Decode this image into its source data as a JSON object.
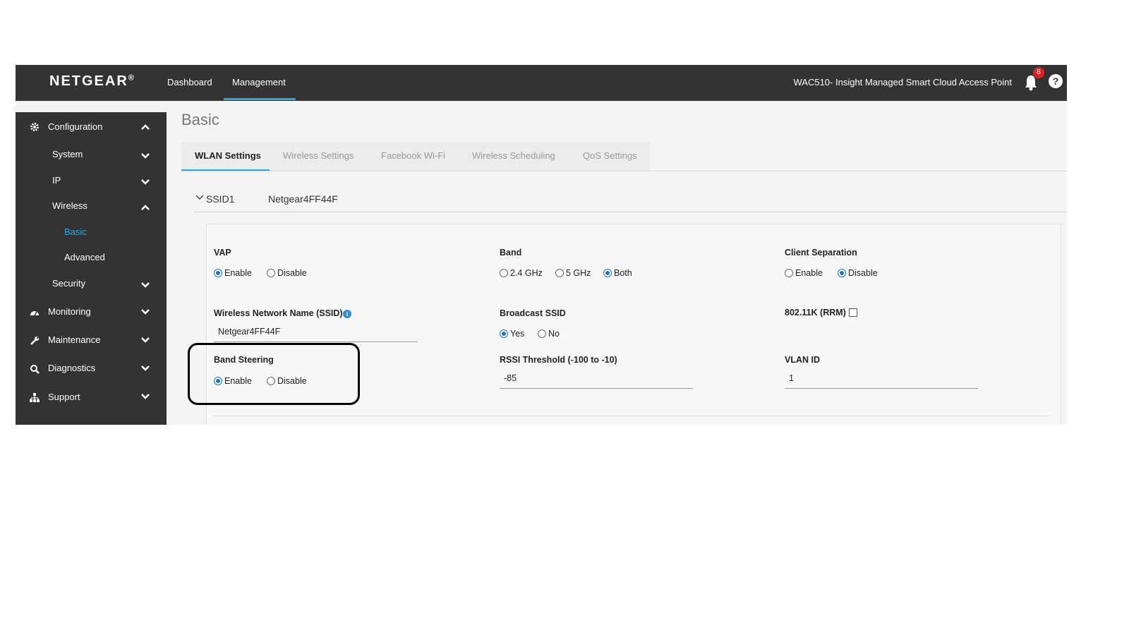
{
  "header": {
    "logo": "NETGEAR",
    "logo_mark": "®",
    "nav": [
      "Dashboard",
      "Management"
    ],
    "device_title": "WAC510- Insight Managed Smart Cloud Access Point",
    "notification_count": "8",
    "help_label": "?",
    "accent_color": "#29a8e0"
  },
  "sidebar": {
    "configuration": "Configuration",
    "system": "System",
    "ip": "IP",
    "wireless": "Wireless",
    "basic": "Basic",
    "advanced": "Advanced",
    "security": "Security",
    "monitoring": "Monitoring",
    "maintenance": "Maintenance",
    "diagnostics": "Diagnostics",
    "support": "Support"
  },
  "main": {
    "title": "Basic",
    "tabs": [
      "WLAN Settings",
      "Wireless Settings",
      "Facebook Wi-Fi",
      "Wireless Scheduling",
      "QoS Settings"
    ],
    "ssid_label": "SSID1",
    "ssid_name": "Netgear4FF44F"
  },
  "form": {
    "vap": {
      "label": "VAP",
      "enable": "Enable",
      "disable": "Disable",
      "selected": "Enable"
    },
    "band": {
      "label": "Band",
      "opt1": "2.4 GHz",
      "opt2": "5 GHz",
      "opt3": "Both",
      "selected": "Both"
    },
    "client_sep": {
      "label": "Client Separation",
      "enable": "Enable",
      "disable": "Disable",
      "selected": "Disable"
    },
    "ssid_field": {
      "label": "Wireless Network Name (SSID)",
      "value": "Netgear4FF44F",
      "info_icon": "i"
    },
    "broadcast": {
      "label": "Broadcast SSID",
      "yes": "Yes",
      "no": "No",
      "selected": "Yes"
    },
    "rrm": {
      "label": "802.11K (RRM)",
      "checked": false
    },
    "band_steering": {
      "label": "Band Steering",
      "enable": "Enable",
      "disable": "Disable",
      "selected": "Enable"
    },
    "rssi": {
      "label": "RSSI Threshold (-100 to -10)",
      "value": "-85"
    },
    "vlan": {
      "label": "VLAN ID",
      "value": "1"
    }
  }
}
